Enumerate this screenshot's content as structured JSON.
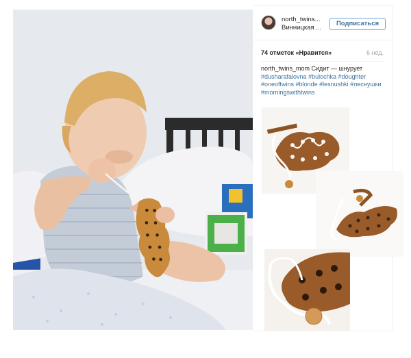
{
  "header": {
    "username": "north_twins...",
    "location": "Винницкая ...",
    "follow_label": "Подписаться"
  },
  "stats": {
    "likes": "74 отметок «Нравится»",
    "time": "6 нед."
  },
  "caption": {
    "author": "north_twins_mom",
    "text": " Сидит — шнурует ",
    "tags": [
      "#dusharafalovna",
      "#bulochka",
      "#doughter",
      "#oneoftwins",
      "#blonde",
      "#lesnushki",
      "#леснушки",
      "#morningswithtwins"
    ]
  },
  "icons": {
    "avatar": "user-avatar",
    "main_photo": "baby-with-lacing-toy-photo",
    "product": "wooden-oak-leaf-lacing-toy"
  },
  "colors": {
    "link": "#3f729b",
    "follow_border": "#70a0d8",
    "wood": "#a0612c"
  }
}
